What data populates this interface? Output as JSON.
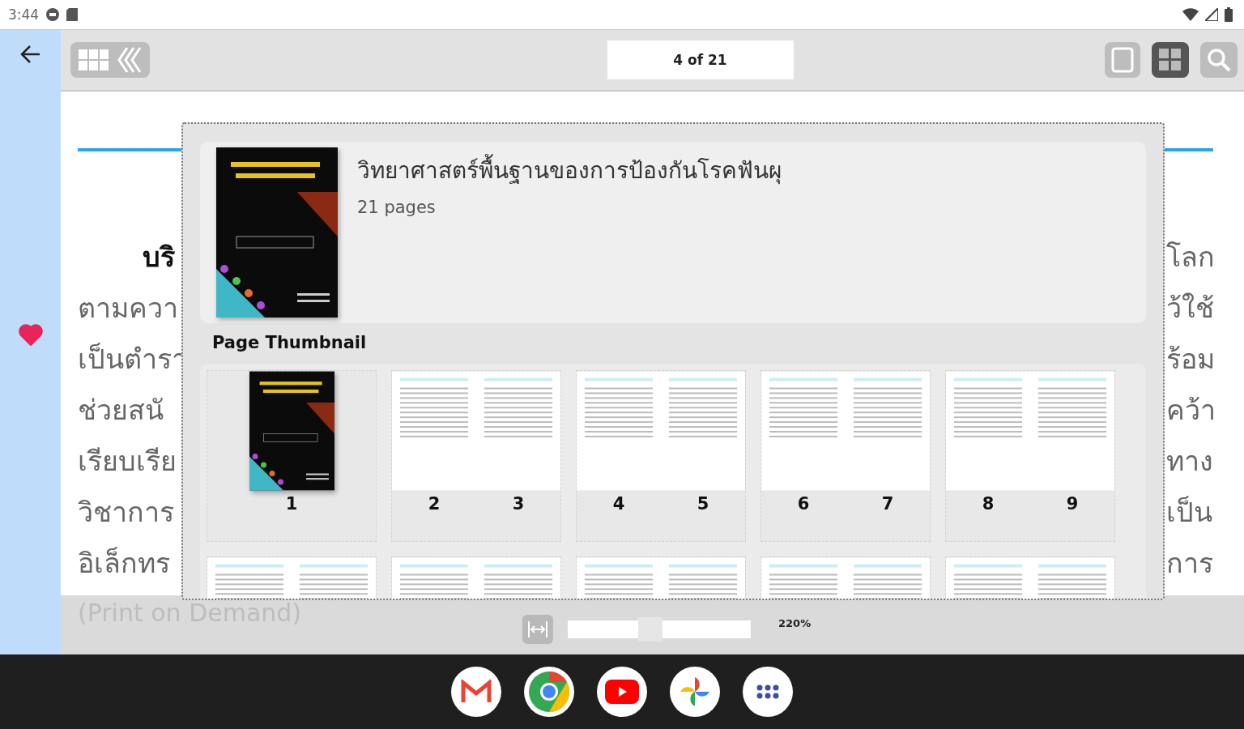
{
  "status_bar": {
    "time": "3:44"
  },
  "rail": {
    "favorite": {
      "on": true
    }
  },
  "toolbar": {
    "page_indicator": "4 of 21"
  },
  "page": {
    "lines": [
      {
        "left": "บริ",
        "right": "โลก",
        "kind": "heading"
      },
      {
        "left": "ตามควา",
        "right": "ว้ใช้",
        "kind": "body"
      },
      {
        "left": "เป็นตำรา",
        "right": "ร้อม",
        "kind": "body"
      },
      {
        "left": "ช่วยสนั",
        "right": "คว้า",
        "kind": "body"
      },
      {
        "left": "เรียบเรีย",
        "right": "ทาง",
        "kind": "body"
      },
      {
        "left": "วิชาการ",
        "right": "เป็น",
        "kind": "body"
      },
      {
        "left": "อิเล็กทร",
        "right": "การ",
        "kind": "body"
      }
    ],
    "footer_text": "(Print on Demand)"
  },
  "zoom": {
    "level": 0.45,
    "reading": "220%"
  },
  "popup": {
    "book": {
      "title": "วิทยาศาสตร์พื้นฐานของการป้องกันโรคฟันผุ",
      "pages": "21 pages"
    },
    "heading": "Page Thumbnail",
    "spreads": [
      {
        "kind": "cover",
        "pages": [
          "1"
        ]
      },
      {
        "kind": "spread",
        "pages": [
          "2",
          "3"
        ]
      },
      {
        "kind": "spread",
        "pages": [
          "4",
          "5"
        ]
      },
      {
        "kind": "spread",
        "pages": [
          "6",
          "7"
        ]
      },
      {
        "kind": "spread",
        "pages": [
          "8",
          "9"
        ]
      },
      {
        "kind": "cut"
      },
      {
        "kind": "cut"
      },
      {
        "kind": "cut"
      },
      {
        "kind": "cut"
      },
      {
        "kind": "cut"
      }
    ]
  }
}
